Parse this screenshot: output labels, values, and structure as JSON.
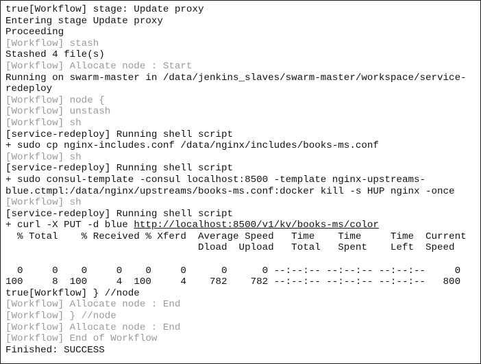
{
  "console": {
    "lines": [
      {
        "text": "true[Workflow] stage: Update proxy",
        "style": "normal"
      },
      {
        "text": "Entering stage Update proxy",
        "style": "normal"
      },
      {
        "text": "Proceeding",
        "style": "normal"
      },
      {
        "text": "[Workflow] stash",
        "style": "gray"
      },
      {
        "text": "Stashed 4 file(s)",
        "style": "normal"
      },
      {
        "text": "[Workflow] Allocate node : Start",
        "style": "gray"
      },
      {
        "text": "Running on swarm-master in /data/jenkins_slaves/swarm-master/workspace/service-",
        "style": "normal"
      },
      {
        "text": "redeploy",
        "style": "normal"
      },
      {
        "text": "[Workflow] node {",
        "style": "gray"
      },
      {
        "text": "[Workflow] unstash",
        "style": "gray"
      },
      {
        "text": "[Workflow] sh",
        "style": "gray"
      },
      {
        "text": "[service-redeploy] Running shell script",
        "style": "normal"
      },
      {
        "text": "+ sudo cp nginx-includes.conf /data/nginx/includes/books-ms.conf",
        "style": "normal"
      },
      {
        "text": "[Workflow] sh",
        "style": "gray"
      },
      {
        "text": "[service-redeploy] Running shell script",
        "style": "normal"
      },
      {
        "text": "+ sudo consul-template -consul localhost:8500 -template nginx-upstreams-",
        "style": "normal"
      },
      {
        "text": "blue.ctmpl:/data/nginx/upstreams/books-ms.conf:docker kill -s HUP nginx -once",
        "style": "normal"
      },
      {
        "text": "[Workflow] sh",
        "style": "gray"
      },
      {
        "text": "[service-redeploy] Running shell script",
        "style": "normal"
      },
      {
        "text": "+ curl -X PUT -d blue ",
        "style": "normal",
        "link": "http://localhost:8500/v1/kv/books-ms/color"
      },
      {
        "text": "  % Total    % Received % Xferd  Average Speed   Time    Time     Time  Current",
        "style": "normal"
      },
      {
        "text": "                                 Dload  Upload   Total   Spent    Left  Speed",
        "style": "normal"
      },
      {
        "text": "",
        "style": "normal"
      },
      {
        "text": "  0     0    0     0    0     0      0      0 --:--:-- --:--:-- --:--:--     0",
        "style": "normal"
      },
      {
        "text": "100     8  100     4  100     4    782    782 --:--:-- --:--:-- --:--:--   800",
        "style": "normal"
      },
      {
        "text": "true[Workflow] } //node",
        "style": "normal"
      },
      {
        "text": "[Workflow] Allocate node : End",
        "style": "gray"
      },
      {
        "text": "[Workflow] } //node",
        "style": "gray"
      },
      {
        "text": "[Workflow] Allocate node : End",
        "style": "gray"
      },
      {
        "text": "[Workflow] End of Workflow",
        "style": "gray"
      },
      {
        "text": "Finished: SUCCESS",
        "style": "normal"
      }
    ]
  }
}
